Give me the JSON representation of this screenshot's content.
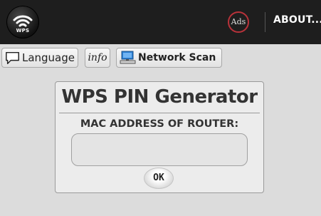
{
  "app": {
    "logo_text": "WPS",
    "logo_icon": "wifi-icon"
  },
  "topbar": {
    "ads_label": "Ads",
    "about_label": "ABOUT..."
  },
  "toolbar": {
    "language_label": "Language",
    "language_icon": "speech-bubble-icon",
    "info_label": "info",
    "network_scan_label": "Network Scan",
    "network_scan_icon": "computer-icon"
  },
  "card": {
    "title": "WPS PIN Generator",
    "mac_label": "MAC ADDRESS OF ROUTER:",
    "mac_value": "",
    "ok_label": "OK"
  },
  "colors": {
    "topbar": "#1e1e1e",
    "background": "#dcdcdc",
    "ads_ring": "#b8323a"
  }
}
